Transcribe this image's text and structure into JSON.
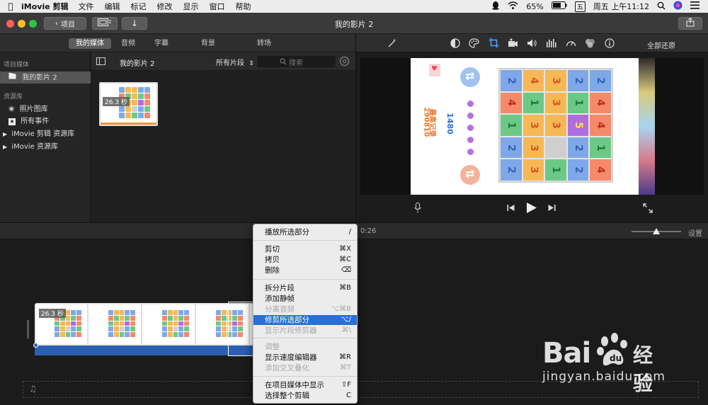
{
  "menubar": {
    "app_name": "iMovie 剪辑",
    "items": [
      "文件",
      "编辑",
      "标记",
      "修改",
      "显示",
      "窗口",
      "帮助"
    ],
    "battery": "65%",
    "input_method": "五",
    "clock": "周五 上午11:12"
  },
  "toolbar": {
    "back_label": "项目",
    "window_title": "我的影片 2"
  },
  "tabs": [
    "我的媒体",
    "音频",
    "字幕",
    "背景",
    "转场"
  ],
  "viewer_tools": {
    "reset_all": "全部还原"
  },
  "sidebar": {
    "section_project": "项目媒体",
    "project_item": "我的影片 2",
    "section_library": "资源库",
    "library_items": [
      "照片图库",
      "所有事件",
      "iMovie 剪辑 资源库",
      "iMovie 资源库"
    ]
  },
  "browser": {
    "title": "我的影片 2",
    "filter": "所有片段",
    "search_placeholder": "搜索",
    "clip_duration": "26.3 秒"
  },
  "game": {
    "high_score_label": "最高记录",
    "high_score": "290810",
    "score": "1480",
    "grid": [
      [
        "2",
        "4",
        "3",
        "2",
        "2"
      ],
      [
        "4",
        "1",
        "3",
        "1",
        "4"
      ],
      [
        "1",
        "3",
        "3",
        "5",
        "4"
      ],
      [
        "2",
        "3",
        "",
        "2",
        "1"
      ],
      [
        "2",
        "3",
        "1",
        "2",
        "4"
      ]
    ],
    "grid_colors": [
      [
        "#7fa8e8",
        "#f6b855",
        "#f6b855",
        "#7fa8e8",
        "#7fa8e8"
      ],
      [
        "#f48a6a",
        "#6cc985",
        "#f6b855",
        "#6cc985",
        "#f48a6a"
      ],
      [
        "#6cc985",
        "#f6b855",
        "#f6b855",
        "#b06de0",
        "#f48a6a"
      ],
      [
        "#7fa8e8",
        "#f6b855",
        "#cfcfcf",
        "#7fa8e8",
        "#6cc985"
      ],
      [
        "#7fa8e8",
        "#f6b855",
        "#6cc985",
        "#7fa8e8",
        "#f48a6a"
      ]
    ],
    "text_colors": {
      "orange": "#e8772e",
      "blue": "#2c6fd6",
      "purple": "#b56fe0"
    }
  },
  "timeline": {
    "timecode": "0:26",
    "settings": "设置",
    "clip_duration": "26.3 秒"
  },
  "context_menu": {
    "items": [
      {
        "label": "播放所选部分",
        "shortcut": "/",
        "disabled": false
      },
      {
        "label": "剪切",
        "shortcut": "⌘X",
        "disabled": false
      },
      {
        "label": "拷贝",
        "shortcut": "⌘C",
        "disabled": false
      },
      {
        "label": "删除",
        "shortcut": "⌫",
        "disabled": false
      },
      {
        "label": "拆分片段",
        "shortcut": "⌘B",
        "disabled": false
      },
      {
        "label": "添加静帧",
        "shortcut": "",
        "disabled": false
      },
      {
        "label": "分离音频",
        "shortcut": "⌥⌘B",
        "disabled": true
      },
      {
        "label": "修剪所选部分",
        "shortcut": "⌥/",
        "disabled": false,
        "highlighted": true
      },
      {
        "label": "显示片段修剪器",
        "shortcut": "⌘\\",
        "disabled": true
      },
      {
        "label": "调整",
        "shortcut": "",
        "disabled": true
      },
      {
        "label": "显示速度编辑器",
        "shortcut": "⌘R",
        "disabled": false
      },
      {
        "label": "添加交叉叠化",
        "shortcut": "⌘T",
        "disabled": true
      },
      {
        "label": "在项目媒体中显示",
        "shortcut": "⇧F",
        "disabled": false
      },
      {
        "label": "选择整个剪辑",
        "shortcut": "C",
        "disabled": false
      }
    ]
  },
  "watermark": {
    "brand": "Bai",
    "brand_cn": "经验",
    "url": "jingyan.baidu.com"
  }
}
